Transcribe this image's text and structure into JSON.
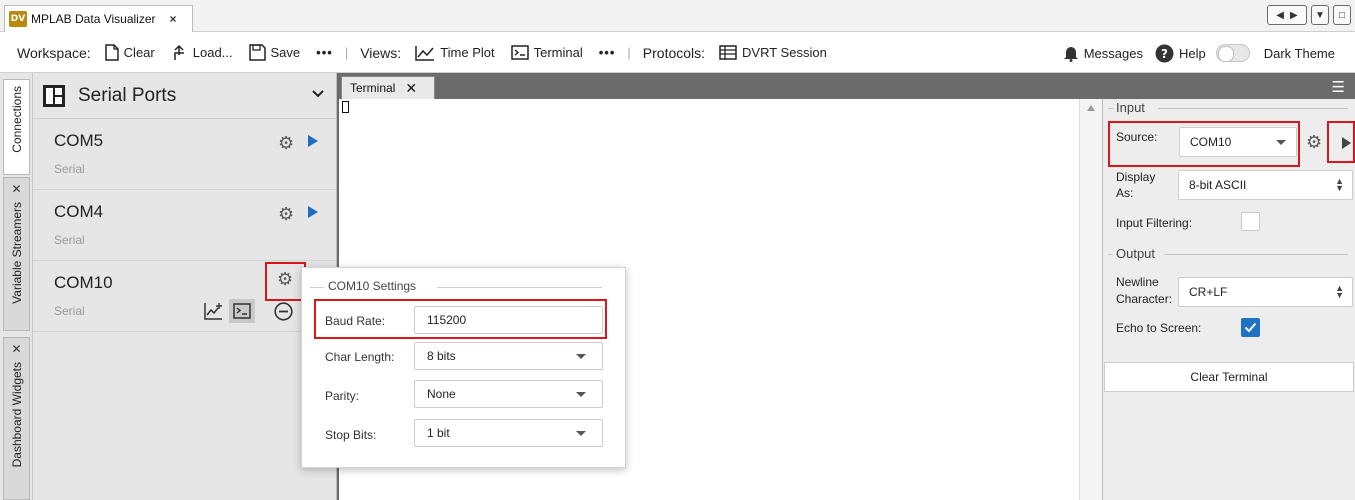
{
  "app": {
    "logo": "DV",
    "title": "MPLAB Data Visualizer",
    "close": "×"
  },
  "toolbar": {
    "workspace_label": "Workspace:",
    "clear": "Clear",
    "load": "Load...",
    "save": "Save",
    "more": "•••",
    "views_label": "Views:",
    "time_plot": "Time Plot",
    "terminal": "Terminal",
    "protocols_label": "Protocols:",
    "dvrt_session": "DVRT Session",
    "messages": "Messages",
    "help": "Help",
    "dark_theme": "Dark Theme",
    "dark_theme_on": false
  },
  "vtabs": {
    "connections": "Connections",
    "variable_streamers": "Variable Streamers",
    "dashboard_widgets": "Dashboard Widgets",
    "close": "✕"
  },
  "ports": {
    "title": "Serial Ports",
    "items": [
      {
        "name": "COM5",
        "type": "Serial"
      },
      {
        "name": "COM4",
        "type": "Serial"
      },
      {
        "name": "COM10",
        "type": "Serial"
      }
    ]
  },
  "terminal": {
    "tab_label": "Terminal",
    "close": "✕"
  },
  "settings_popup": {
    "title": "COM10 Settings",
    "baud_rate_label": "Baud Rate:",
    "baud_rate_value": "115200",
    "char_length_label": "Char Length:",
    "char_length_value": "8 bits",
    "parity_label": "Parity:",
    "parity_value": "None",
    "stop_bits_label": "Stop Bits:",
    "stop_bits_value": "1 bit"
  },
  "right_panel": {
    "input_title": "Input",
    "source_label": "Source:",
    "source_value": "COM10",
    "display_as_label_1": "Display",
    "display_as_label_2": "As:",
    "display_as_value": "8-bit ASCII",
    "input_filtering_label": "Input Filtering:",
    "input_filtering_checked": false,
    "output_title": "Output",
    "newline_label_1": "Newline",
    "newline_label_2": "Character:",
    "newline_value": "CR+LF",
    "echo_label": "Echo to Screen:",
    "echo_checked": true,
    "clear_terminal": "Clear Terminal"
  },
  "colors": {
    "highlight": "#d9161c",
    "accent": "#1f73c2",
    "tab_header": "#6b6b6b"
  }
}
